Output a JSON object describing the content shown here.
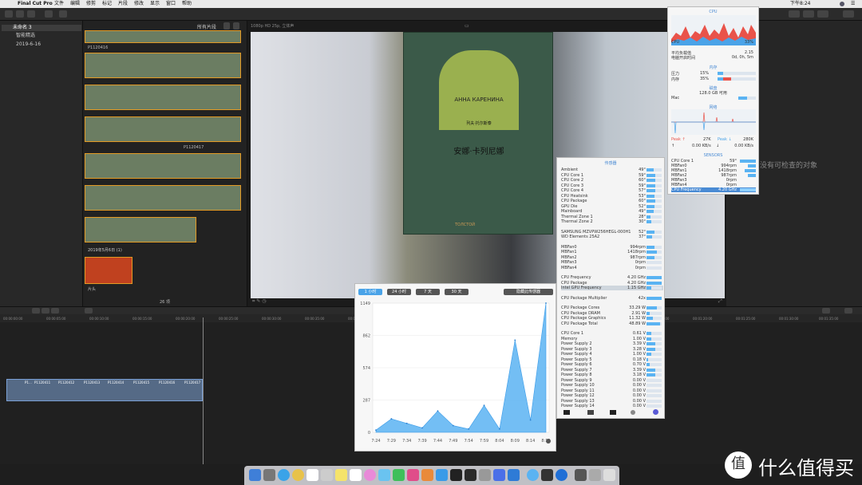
{
  "menubar": {
    "app_name": "Final Cut Pro",
    "items": [
      "文件",
      "编辑",
      "修剪",
      "标记",
      "片段",
      "修改",
      "显示",
      "窗口",
      "帮助"
    ],
    "clock": "下午8:24"
  },
  "browser": {
    "library": "未命名 3",
    "smart_collections": "智能精选",
    "event": "2019-6-16"
  },
  "clips_header": {
    "filter_label": "所有片段"
  },
  "clip_labels": [
    "P1120416",
    "P1120417"
  ],
  "date_group": {
    "label": "2019年5月6日",
    "count": "(1)"
  },
  "clip_special": {
    "label": "片头"
  },
  "clips_count": "26 项",
  "viewer": {
    "format": "1080p HD 25p, 立体声"
  },
  "inspector": {
    "empty_text": "没有可检查的对象"
  },
  "book": {
    "title": "安娜·卡列尼娜",
    "russian_title": "АННА КАРЕНИНА",
    "author_line": "列夫·托尔斯泰",
    "publisher": "ТОЛСТОЙ"
  },
  "ruler_ticks": [
    "00:00:00:00",
    "00:00:05:00",
    "00:00:10:00",
    "00:00:15:00",
    "00:00:20:00",
    "00:00:25:00",
    "00:00:30:00",
    "00:00:35:00",
    "00:00:40:00",
    "00:00:45:00",
    "00:00:50:00",
    "00:00:55:00",
    "00:01:00:00",
    "00:01:05:00",
    "00:01:10:00",
    "00:01:15:00",
    "00:01:20:00",
    "00:01:25:00",
    "00:01:30:00",
    "00:01:35:00"
  ],
  "timeline_clips": [
    "P1...",
    "P1120411",
    "P1120412",
    "P1120413",
    "P1120414",
    "P1120415",
    "P1120416",
    "P1120417"
  ],
  "cpu_window": {
    "title": "CPU",
    "cpu_label": "CPU",
    "cpu_value": "33%",
    "load_label": "平均负载值",
    "load_value": "2.15",
    "uptime_label": "电脑开启时间",
    "uptime_value": "0d, 0h, 5m",
    "mem_title": "内存",
    "pressure_label": "压力",
    "pressure_value": "15%",
    "mem_label": "内存",
    "mem_value": "35%",
    "disk_title": "磁盘",
    "disk_avail": "128.0 GB 可用",
    "disk_name": "Mac",
    "net_title": "网络",
    "peak_up_label": "Peak ↑",
    "peak_up_value": "27K",
    "peak_down_label": "Peak ↓",
    "peak_down_value": "280K",
    "rate_up": "0.00 KB/s",
    "rate_down": "0.00 KB/s",
    "sensors_title": "SENSORS",
    "sensors": [
      {
        "label": "CPU Core 1",
        "value": "59°"
      },
      {
        "label": "MBFan0",
        "value": "994rpm"
      },
      {
        "label": "MBFan1",
        "value": "1418rpm"
      },
      {
        "label": "MBFan2",
        "value": "987rpm"
      },
      {
        "label": "MBFan3",
        "value": "0rpm"
      },
      {
        "label": "MBFan4",
        "value": "0rpm"
      },
      {
        "label": "CPU Frequency",
        "value": "4.20 GHz"
      }
    ]
  },
  "sensors_window": {
    "title": "传感器",
    "rows": [
      {
        "label": "Ambient",
        "value": "49°",
        "level": 0.49
      },
      {
        "label": "CPU Core 1",
        "value": "59°",
        "level": 0.59
      },
      {
        "label": "CPU Core 2",
        "value": "60°",
        "level": 0.6
      },
      {
        "label": "CPU Core 3",
        "value": "59°",
        "level": 0.59
      },
      {
        "label": "CPU Core 4",
        "value": "57°",
        "level": 0.57
      },
      {
        "label": "CPU Heatsink",
        "value": "53°",
        "level": 0.53
      },
      {
        "label": "CPU Package",
        "value": "60°",
        "level": 0.6
      },
      {
        "label": "GPU Die",
        "value": "52°",
        "level": 0.52
      },
      {
        "label": "Mainboard",
        "value": "49°",
        "level": 0.49
      },
      {
        "label": "Thermal Zone 1",
        "value": "28°",
        "level": 0.28
      },
      {
        "label": "Thermal Zone 2",
        "value": "30°",
        "level": 0.3
      },
      {
        "label": "SAMSUNG MZVPW256HEGL-000H1",
        "value": "52°",
        "level": 0.52
      },
      {
        "label": "WD Elements 25A2",
        "value": "37°",
        "level": 0.37
      },
      {
        "label": "MBFan0",
        "value": "994rpm",
        "level": 0.5
      },
      {
        "label": "MBFan1",
        "value": "1418rpm",
        "level": 0.7
      },
      {
        "label": "MBFan2",
        "value": "987rpm",
        "level": 0.5
      },
      {
        "label": "MBFan3",
        "value": "0rpm",
        "level": 0
      },
      {
        "label": "MBFan4",
        "value": "0rpm",
        "level": 0
      },
      {
        "label": "CPU Frequency",
        "value": "4.20 GHz",
        "level": 1
      },
      {
        "label": "CPU Package",
        "value": "4.20 GHz",
        "level": 1
      },
      {
        "label": "Intel GPU Frequency",
        "value": "1.15 GHz",
        "level": 0.3
      },
      {
        "label": "CPU Package Multiplier",
        "value": "42x",
        "level": 1
      },
      {
        "label": "CPU Package Cores",
        "value": "33.29 W",
        "level": 0.7
      },
      {
        "label": "CPU Package DRAM",
        "value": "2.91 W",
        "level": 0.2
      },
      {
        "label": "CPU Package Graphics",
        "value": "11.32 W",
        "level": 0.4
      },
      {
        "label": "CPU Package Total",
        "value": "48.89 W",
        "level": 0.9
      },
      {
        "label": "CPU Core 1",
        "value": "0.61 V",
        "level": 0.3
      },
      {
        "label": "Memory",
        "value": "1.00 V",
        "level": 0.3
      },
      {
        "label": "Power Supply 2",
        "value": "3.39 V",
        "level": 0.6
      },
      {
        "label": "Power Supply 3",
        "value": "3.28 V",
        "level": 0.6
      },
      {
        "label": "Power Supply 4",
        "value": "1.00 V",
        "level": 0.3
      },
      {
        "label": "Power Supply 5",
        "value": "0.18 V",
        "level": 0.1
      },
      {
        "label": "Power Supply 6",
        "value": "0.70 V",
        "level": 0.2
      },
      {
        "label": "Power Supply 7",
        "value": "3.39 V",
        "level": 0.6
      },
      {
        "label": "Power Supply 8",
        "value": "3.18 V",
        "level": 0.6
      },
      {
        "label": "Power Supply 9",
        "value": "0.00 V",
        "level": 0
      },
      {
        "label": "Power Supply 10",
        "value": "0.00 V",
        "level": 0
      },
      {
        "label": "Power Supply 11",
        "value": "0.00 V",
        "level": 0
      },
      {
        "label": "Power Supply 12",
        "value": "0.00 V",
        "level": 0
      },
      {
        "label": "Power Supply 13",
        "value": "0.00 V",
        "level": 0
      },
      {
        "label": "Power Supply 14",
        "value": "0.00 V",
        "level": 0
      }
    ]
  },
  "graph_window": {
    "tabs": [
      "1 小时",
      "24 小时",
      "7 天",
      "30 天"
    ],
    "active_tab": "1 小时",
    "hide_button": "隐藏此传感器",
    "y_ticks": [
      "1149",
      "862",
      "574",
      "287",
      "0"
    ],
    "x_ticks": [
      "7:24",
      "7:29",
      "7:34",
      "7:39",
      "7:44",
      "7:49",
      "7:54",
      "7:59",
      "8:04",
      "8:09",
      "8:14",
      "8:19"
    ]
  },
  "chart_data": {
    "type": "area",
    "title": "",
    "xlabel": "",
    "ylabel": "",
    "ylim": [
      0,
      1149
    ],
    "x": [
      "7:24",
      "7:29",
      "7:34",
      "7:39",
      "7:44",
      "7:49",
      "7:54",
      "7:59",
      "8:04",
      "8:09",
      "8:14",
      "8:19"
    ],
    "series": [
      {
        "values": [
          20,
          120,
          80,
          40,
          190,
          60,
          30,
          240,
          30,
          820,
          110,
          1149
        ]
      }
    ]
  },
  "watermark": {
    "text": "什么值得买"
  }
}
